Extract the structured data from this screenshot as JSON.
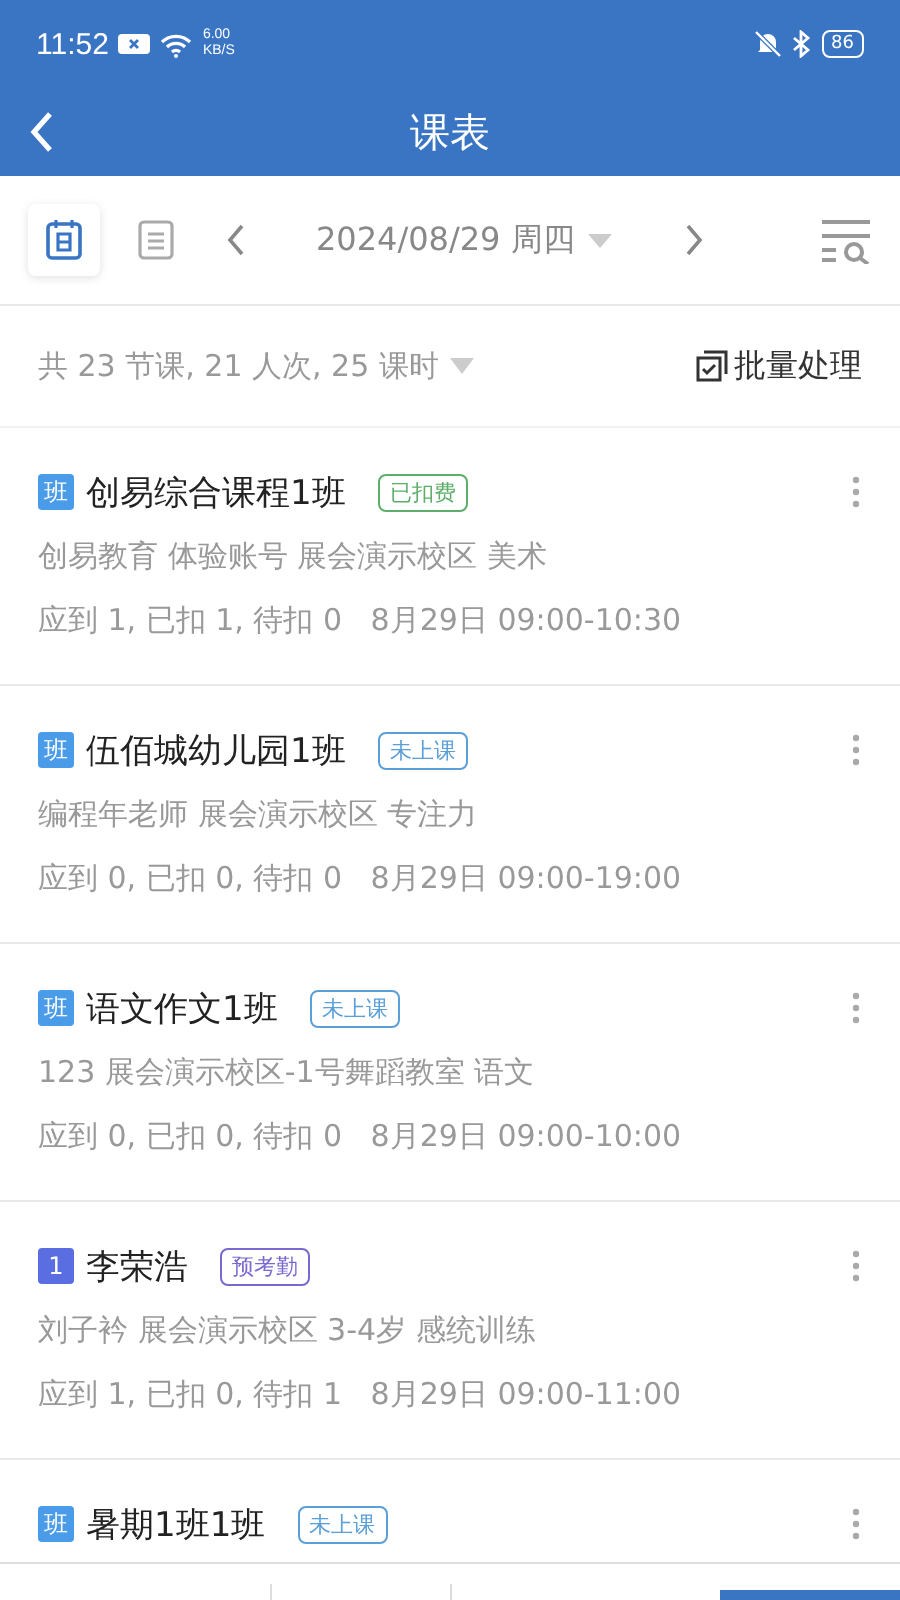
{
  "status_bar": {
    "time": "11:52",
    "speed_value": "6.00",
    "speed_unit": "KB/S",
    "battery": "86"
  },
  "header": {
    "title": "课表"
  },
  "toolbar": {
    "views": [
      {
        "kind": "calendar",
        "selected": true
      },
      {
        "kind": "list",
        "selected": false
      }
    ],
    "date": "2024/08/29 周四"
  },
  "summary": {
    "text": "共 23 节课, 21 人次, 25 课时",
    "batch": "批量处理"
  },
  "lessons": [
    {
      "badge": {
        "text": "班",
        "color": "#4a9be8"
      },
      "title": "创易综合课程1班",
      "tag": {
        "text": "已扣费",
        "color": "#5cae6a"
      },
      "line1": "创易教育 体验账号 展会演示校区 美术",
      "line2": "应到 1, 已扣 1, 待扣 0   8月29日 09:00-10:30"
    },
    {
      "badge": {
        "text": "班",
        "color": "#4a9be8"
      },
      "title": "伍佰城幼儿园1班",
      "tag": {
        "text": "未上课",
        "color": "#5a9fd8"
      },
      "line1": "编程年老师 展会演示校区 专注力",
      "line2": "应到 0, 已扣 0, 待扣 0   8月29日 09:00-19:00"
    },
    {
      "badge": {
        "text": "班",
        "color": "#4a9be8"
      },
      "title": "语文作文1班",
      "tag": {
        "text": "未上课",
        "color": "#5a9fd8"
      },
      "line1": "123 展会演示校区-1号舞蹈教室 语文",
      "line2": "应到 0, 已扣 0, 待扣 0   8月29日 09:00-10:00"
    },
    {
      "badge": {
        "text": "1",
        "color": "#5b6ee1"
      },
      "title": "李荣浩",
      "tag": {
        "text": "预考勤",
        "color": "#7a68d0"
      },
      "line1": "刘子衿 展会演示校区 3-4岁 感统训练",
      "line2": "应到 1, 已扣 0, 待扣 1   8月29日 09:00-11:00"
    },
    {
      "badge": {
        "text": "班",
        "color": "#4a9be8"
      },
      "title": "暑期1班1班",
      "tag": {
        "text": "未上课",
        "color": "#5a9fd8"
      }
    }
  ]
}
